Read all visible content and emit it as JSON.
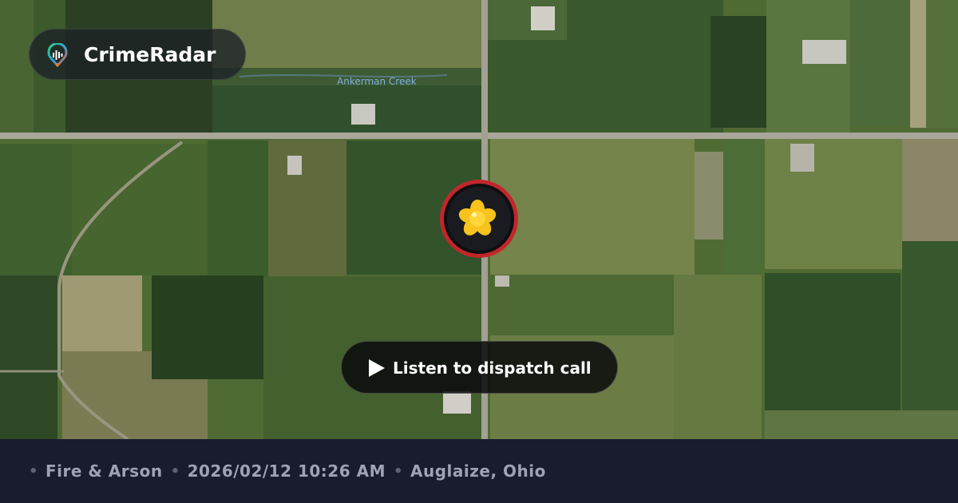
{
  "brand": {
    "name": "CrimeRadar",
    "logo_icon": "radar-pin-icon"
  },
  "map": {
    "creek_label": "Ankerman Creek",
    "incident_icon": "fire-asterisk-icon",
    "marker_ring_color": "#c2262b",
    "marker_glyph_color": "#f7c31c"
  },
  "player": {
    "label": "Listen to dispatch call",
    "icon": "play-icon"
  },
  "footer": {
    "category": "Fire & Arson",
    "datetime": "2026/02/12 10:26 AM",
    "location": "Auglaize, Ohio"
  }
}
